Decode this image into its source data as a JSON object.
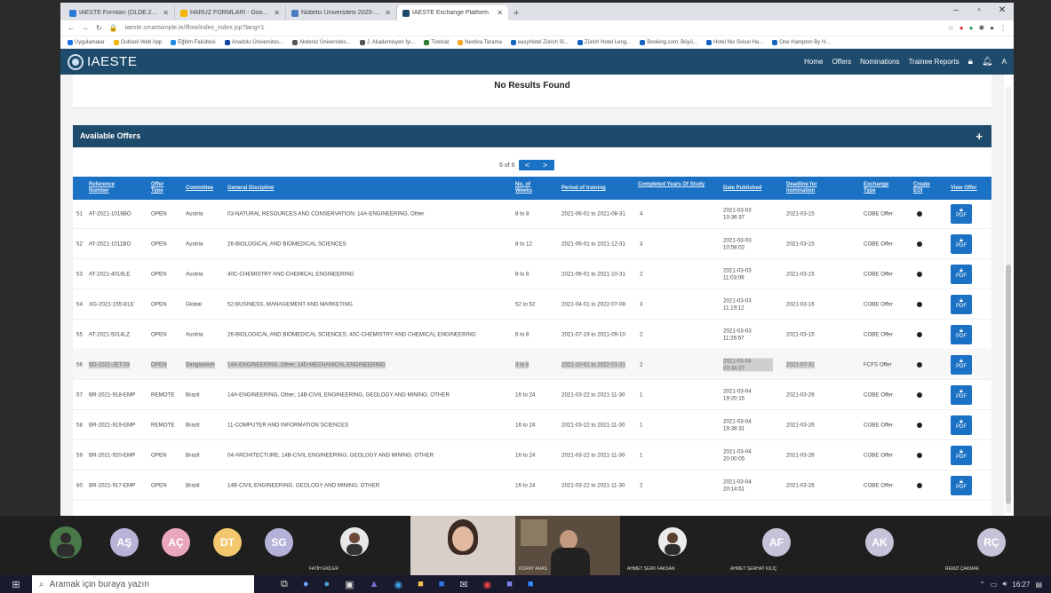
{
  "browser": {
    "tabs": [
      {
        "title": "IAESTE Formları (DLDE.2021) | F...",
        "color": "#2a7bd6",
        "active": false
      },
      {
        "title": "HARUZ FORMLARI - Google Drive",
        "color": "#f4b400",
        "active": false
      },
      {
        "title": "Nobetci Üniversitesi 2020-2021",
        "color": "#4a7dbf",
        "active": false
      },
      {
        "title": "IAESTE Exchange Platform",
        "color": "#1e4a6b",
        "active": true
      }
    ],
    "new_tab": "+",
    "url": "iaeste.smartsimple.ie/iflow/index_index.jsp?lang=1",
    "bookmarks": [
      "Uygulamalar",
      "Outlook Web App",
      "Eğitim Fakültesi",
      "Anadolu Üniversites...",
      "Akdeniz Üniversites...",
      "J. Akademisyen İyi...",
      "Tutorial",
      "Nextiva Tarama",
      "easyHotel Zürich Si...",
      "Zürich Hotel Leng...",
      "Booking.com: Büyü...",
      "Hotel Nix Svisel Ha...",
      "One Hampton By H..."
    ]
  },
  "site": {
    "logo": "IAESTE",
    "nav": [
      "Home",
      "Offers",
      "Nominations",
      "Trainee Reports"
    ],
    "user_initial": "A"
  },
  "no_results": "No Results Found",
  "offers": {
    "title": "Available Offers",
    "plus": "+",
    "pager": {
      "text": "6 of 6",
      "prev": "<",
      "next": ">"
    },
    "headers": {
      "ref": "Reference Number",
      "type": "Offer Type",
      "committee": "Committee",
      "discipline": "General Discipline",
      "weeks": "No. of Weeks",
      "period": "Period of training",
      "years": "Completed Years Of Study",
      "published": "Date Published",
      "deadline": "Deadline for nomination",
      "exchange": "Exchange Type",
      "eoi": "Create EOI",
      "view": "View Offer"
    },
    "rows": [
      {
        "num": "51",
        "ref": "AT-2021-1016BO",
        "type": "OPEN",
        "committee": "Austria",
        "discipline": "03-NATURAL RESOURCES AND CONSERVATION; 14A-ENGINEERING, Other",
        "weeks": "8 to 8",
        "period": "2021-06-01 to 2021-08-31",
        "years": "4",
        "published": "2021-03-03 10:36:37",
        "deadline": "2021-03-15",
        "exchange": "COBE Offer",
        "highlight": false
      },
      {
        "num": "52",
        "ref": "AT-2021-1011BO",
        "type": "OPEN",
        "committee": "Austria",
        "discipline": "26-BIOLOGICAL AND BIOMEDICAL SCIENCES",
        "weeks": "8 to 12",
        "period": "2021-06-01 to 2021-12-31",
        "years": "3",
        "published": "2021-03-03 10:58:02",
        "deadline": "2021-03-15",
        "exchange": "COBE Offer",
        "highlight": false
      },
      {
        "num": "53",
        "ref": "AT-2021-4016LE",
        "type": "OPEN",
        "committee": "Austria",
        "discipline": "40C-CHEMISTRY AND CHEMICAL ENGINEERING",
        "weeks": "8 to 8",
        "period": "2021-06-01 to 2021-10-31",
        "years": "2",
        "published": "2021-03-03 11:03:09",
        "deadline": "2021-03-15",
        "exchange": "COBE Offer",
        "highlight": false
      },
      {
        "num": "54",
        "ref": "XG-2021-155-ELE",
        "type": "OPEN",
        "committee": "Global",
        "discipline": "52-BUSINESS, MANAGEMENT AND MARKETING",
        "weeks": "52 to 52",
        "period": "2021-04-01 to 2022-07-08",
        "years": "3",
        "published": "2021-03-03 11:19:12",
        "deadline": "2021-03-16",
        "exchange": "COBE Offer",
        "highlight": false
      },
      {
        "num": "55",
        "ref": "AT-2021-5014LZ",
        "type": "OPEN",
        "committee": "Austria",
        "discipline": "26-BIOLOGICAL AND BIOMEDICAL SCIENCES; 40C-CHEMISTRY AND CHEMICAL ENGINEERING",
        "weeks": "6 to 8",
        "period": "2021-07-19 to 2021-09-10",
        "years": "2",
        "published": "2021-03-03 11:26:57",
        "deadline": "2021-03-15",
        "exchange": "COBE Offer",
        "highlight": false
      },
      {
        "num": "56",
        "ref": "BD-2021-JET-03",
        "type": "OPEN",
        "committee": "Bangladesh",
        "discipline": "14A-ENGINEERING, Other; 14D-MECHANICAL ENGINEERING",
        "weeks": "4 to 8",
        "period": "2021-10-01 to 2022-01-31",
        "years": "2",
        "published": "2021-03-04 03:34:27",
        "deadline": "2021-07-31",
        "exchange": "FCFS Offer",
        "highlight": true
      },
      {
        "num": "57",
        "ref": "BR-2021-918-EMP",
        "type": "REMOTE",
        "committee": "Brazil",
        "discipline": "14A-ENGINEERING, Other; 14B-CIVIL ENGINEERING, GEOLOGY AND MINING; OTHER",
        "weeks": "16 to 24",
        "period": "2021-03-22 to 2021-11-30",
        "years": "1",
        "published": "2021-03-04 19:20:15",
        "deadline": "2021-03-26",
        "exchange": "COBE Offer",
        "highlight": false
      },
      {
        "num": "58",
        "ref": "BR-2021-919-EMP",
        "type": "REMOTE",
        "committee": "Brazil",
        "discipline": "11-COMPUTER AND INFORMATION SCIENCES",
        "weeks": "16 to 24",
        "period": "2021-03-22 to 2021-11-30",
        "years": "1",
        "published": "2021-03-04 19:38:31",
        "deadline": "2021-03-26",
        "exchange": "COBE Offer",
        "highlight": false
      },
      {
        "num": "59",
        "ref": "BR-2021-920-EMP",
        "type": "OPEN",
        "committee": "Brazil",
        "discipline": "04-ARCHITECTURE; 14B-CIVIL ENGINEERING, GEOLOGY AND MINING; OTHER",
        "weeks": "16 to 24",
        "period": "2021-03-22 to 2021-11-30",
        "years": "1",
        "published": "2021-03-04 20:00:05",
        "deadline": "2021-03-26",
        "exchange": "COBE Offer",
        "highlight": false
      },
      {
        "num": "60",
        "ref": "BR-2021-917-EMP",
        "type": "OPEN",
        "committee": "Brazil",
        "discipline": "14B-CIVIL ENGINEERING, GEOLOGY AND MINING; OTHER",
        "weeks": "16 to 24",
        "period": "2021-03-22 to 2021-11-30",
        "years": "2",
        "published": "2021-03-04 20:14:51",
        "deadline": "2021-03-26",
        "exchange": "COBE Offer",
        "highlight": false
      }
    ],
    "pdf_label": "PDF"
  },
  "meeting": {
    "avatars": [
      {
        "initials": "AŞ",
        "color": "#b8b4d8"
      },
      {
        "initials": "AÇ",
        "color": "#e8a6bf"
      },
      {
        "initials": "DT",
        "color": "#f2c76e"
      },
      {
        "initials": "SG",
        "color": "#b5b2d9"
      },
      {
        "initials": "AF",
        "color": "#c5c3d8"
      },
      {
        "initials": "AK",
        "color": "#c5c3d8"
      },
      {
        "initials": "RÇ",
        "color": "#c5c3d8"
      }
    ],
    "names": [
      "FATİH EKİLER",
      "KORAY ARAS",
      "AHMET SERK FAKSAN",
      "AHMET SERHAT KILIÇ",
      "REMZİ ÇAKMAK"
    ]
  },
  "taskbar": {
    "search_placeholder": "Aramak için buraya yazın",
    "time": "16:27"
  }
}
